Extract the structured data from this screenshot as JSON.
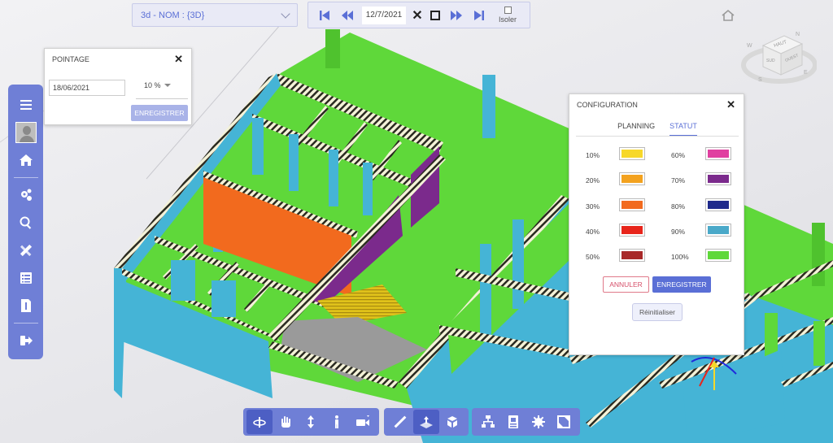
{
  "view_select": {
    "label": "3d - NOM : {3D}"
  },
  "timeline": {
    "date": "12/7/2021",
    "isoler_label": "Isoler"
  },
  "pointage": {
    "title": "POINTAGE",
    "date_value": "18/06/2021",
    "percent_value": "10 %",
    "save_label": "ENREGISTRER"
  },
  "configuration": {
    "title": "CONFIGURATION",
    "tabs": [
      {
        "label": "PLANNING"
      },
      {
        "label": "STATUT"
      }
    ],
    "rows": [
      {
        "left": {
          "label": "10%",
          "color": "#f7d82a"
        },
        "right": {
          "label": "60%",
          "color": "#e040a0"
        }
      },
      {
        "left": {
          "label": "20%",
          "color": "#f3a21f"
        },
        "right": {
          "label": "70%",
          "color": "#7b2a8c"
        }
      },
      {
        "left": {
          "label": "30%",
          "color": "#f26a1e"
        },
        "right": {
          "label": "80%",
          "color": "#1f2a8c"
        }
      },
      {
        "left": {
          "label": "40%",
          "color": "#e8251b"
        },
        "right": {
          "label": "90%",
          "color": "#4aa9c9"
        }
      },
      {
        "left": {
          "label": "50%",
          "color": "#a82828"
        },
        "right": {
          "label": "100%",
          "color": "#5fd83a"
        }
      }
    ],
    "cancel_label": "ANNULER",
    "save_label": "ENREGISTRER",
    "reset_label": "Réinitialiser"
  },
  "navcube": {
    "top_label": "HAUT",
    "front_label": "SUD",
    "side_label": "OUEST",
    "compass": [
      "N",
      "E",
      "S",
      "W"
    ]
  },
  "colors": {
    "accent": "#6f7fd6",
    "slab": "#5fd83a",
    "walls": "#45b4d6",
    "orange": "#f26a1e",
    "purple": "#7b2a8c",
    "stairs": "#e0c21a"
  }
}
